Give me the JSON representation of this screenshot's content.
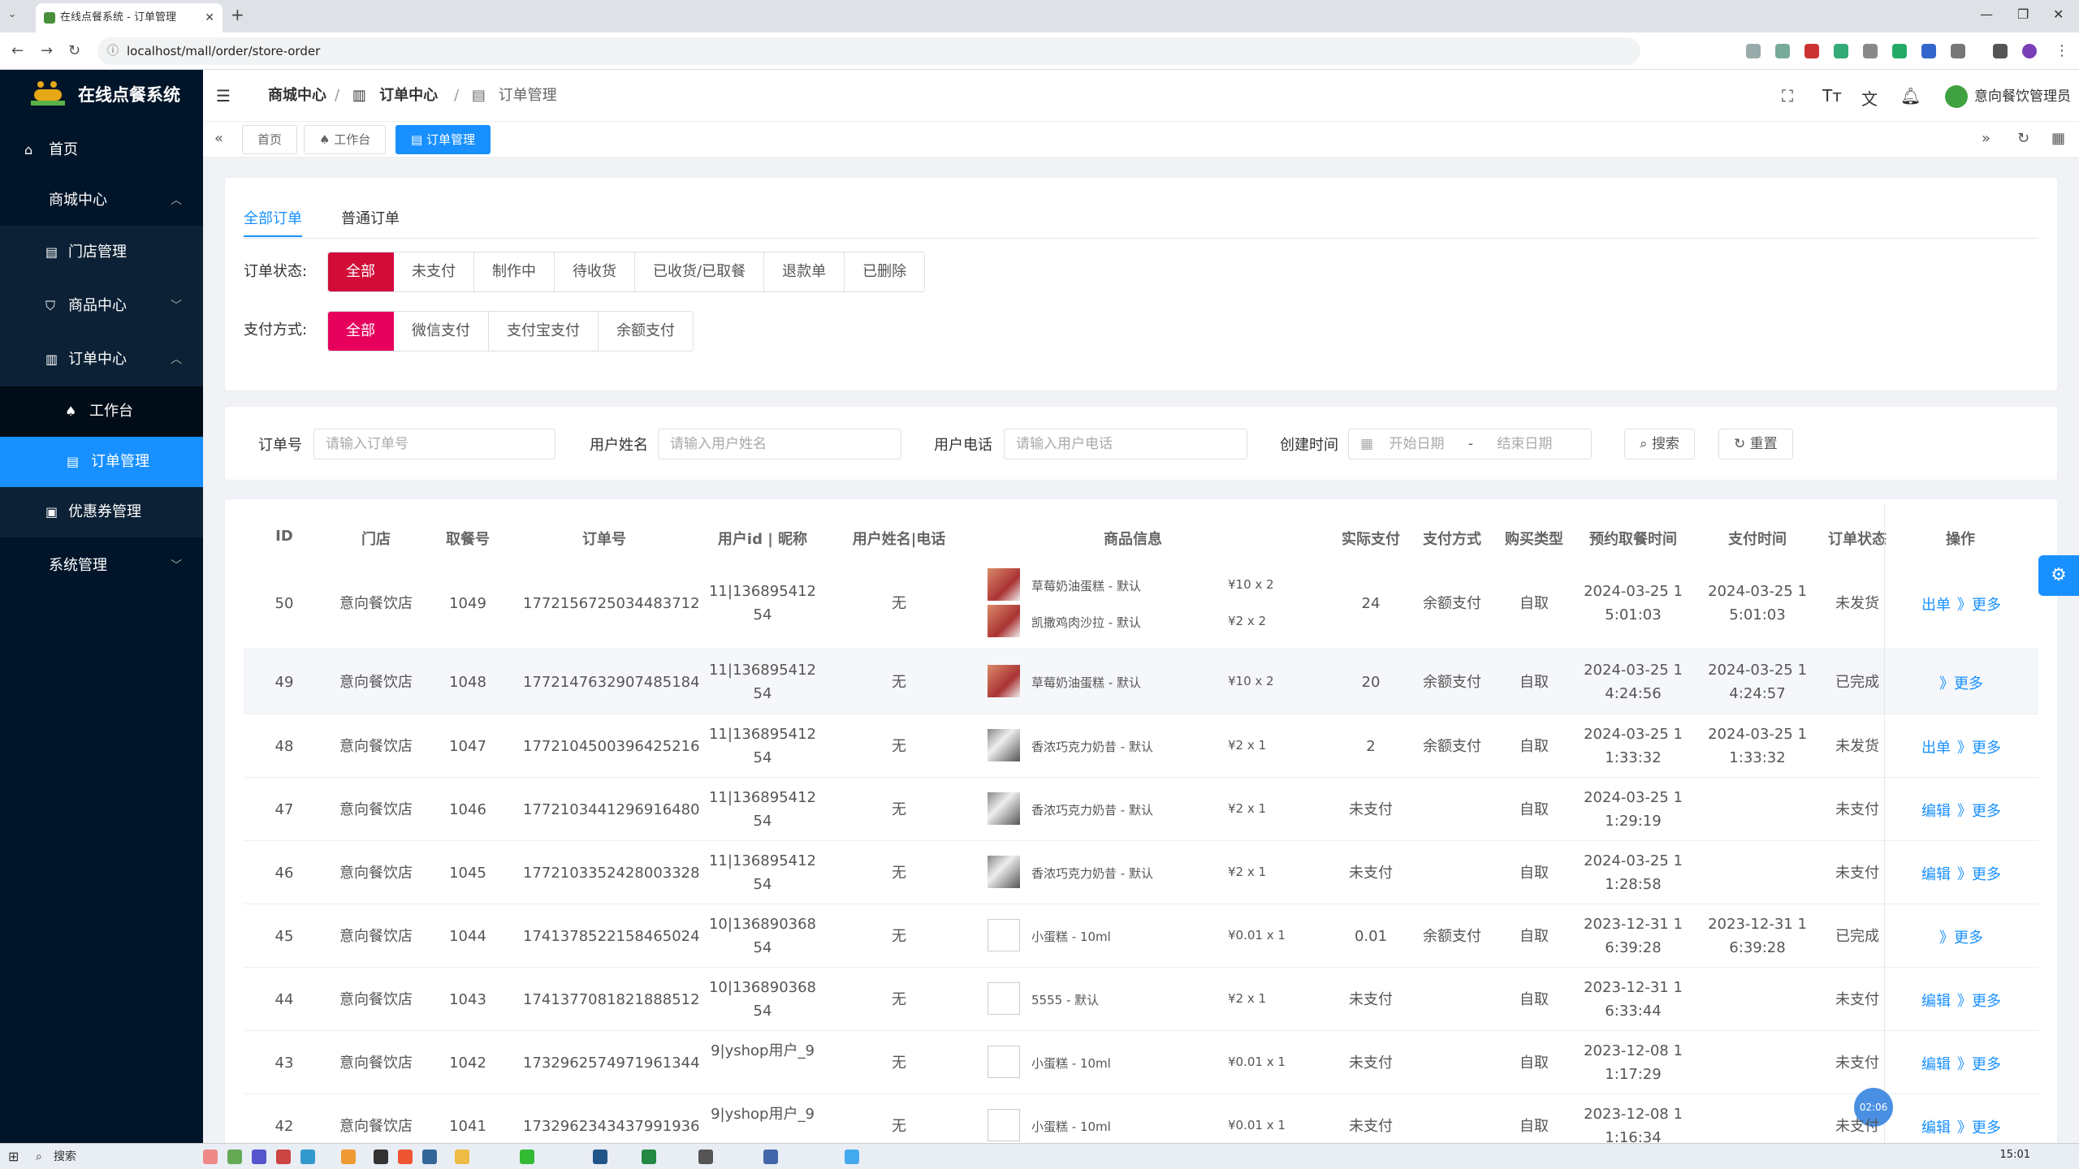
{
  "browser": {
    "tab_title": "在线点餐系统 - 订单管理",
    "url": "localhost/mall/order/store-order"
  },
  "app": {
    "name": "在线点餐系统"
  },
  "sidebar": {
    "home": "首页",
    "mall_center": "商城中心",
    "store_mgmt": "门店管理",
    "product_center": "商品中心",
    "order_center": "订单中心",
    "workbench": "工作台",
    "order_mgmt": "订单管理",
    "coupon_mgmt": "优惠券管理",
    "system_mgmt": "系统管理"
  },
  "header": {
    "breadcrumb": [
      "商城中心",
      "订单中心",
      "订单管理"
    ],
    "user": "意向餐饮管理员"
  },
  "tags": [
    "首页",
    "工作台",
    "订单管理"
  ],
  "filters": {
    "tabs": [
      "全部订单",
      "普通订单"
    ],
    "status_label": "订单状态:",
    "status_options": [
      "全部",
      "未支付",
      "制作中",
      "待收货",
      "已收货/已取餐",
      "退款单",
      "已删除"
    ],
    "pay_label": "支付方式:",
    "pay_options": [
      "全部",
      "微信支付",
      "支付宝支付",
      "余额支付"
    ]
  },
  "search": {
    "order_no_label": "订单号",
    "order_no_placeholder": "请输入订单号",
    "user_name_label": "用户姓名",
    "user_name_placeholder": "请输入用户姓名",
    "user_phone_label": "用户电话",
    "user_phone_placeholder": "请输入用户电话",
    "created_label": "创建时间",
    "start_date": "开始日期",
    "dash": "-",
    "end_date": "结束日期",
    "search_btn": "搜索",
    "reset_btn": "重置"
  },
  "table": {
    "headers": [
      "ID",
      "门店",
      "取餐号",
      "订单号",
      "用户id | 昵称",
      "用户姓名|电话",
      "商品信息",
      "实际支付",
      "支付方式",
      "购买类型",
      "预约取餐时间",
      "支付时间",
      "订单状态",
      "操作"
    ],
    "rows": [
      {
        "id": "50",
        "store": "意向餐饮店",
        "pickup": "1049",
        "order_no": "1772156725034483712",
        "user1": "11|136895412",
        "user2": "54",
        "name": "无",
        "products": [
          {
            "name": "草莓奶油蛋糕 - 默认",
            "qty": "¥10 x 2",
            "img": "photo"
          },
          {
            "name": "凯撒鸡肉沙拉 - 默认",
            "qty": "¥2 x 2",
            "img": "photo"
          }
        ],
        "paid": "24",
        "method": "余额支付",
        "type": "自取",
        "reserve1": "2024-03-25 1",
        "reserve2": "5:01:03",
        "paytime1": "2024-03-25 1",
        "paytime2": "5:01:03",
        "status": "未发货",
        "ops": [
          "出单",
          "》更多"
        ]
      },
      {
        "id": "49",
        "store": "意向餐饮店",
        "pickup": "1048",
        "order_no": "1772147632907485184",
        "user1": "11|136895412",
        "user2": "54",
        "name": "无",
        "products": [
          {
            "name": "草莓奶油蛋糕 - 默认",
            "qty": "¥10 x 2",
            "img": "photo"
          }
        ],
        "paid": "20",
        "method": "余额支付",
        "type": "自取",
        "reserve1": "2024-03-25 1",
        "reserve2": "4:24:56",
        "paytime1": "2024-03-25 1",
        "paytime2": "4:24:57",
        "status": "已完成",
        "ops": [
          "》更多"
        ]
      },
      {
        "id": "48",
        "store": "意向餐饮店",
        "pickup": "1047",
        "order_no": "1772104500396425216",
        "user1": "11|136895412",
        "user2": "54",
        "name": "无",
        "products": [
          {
            "name": "香浓巧克力奶昔 - 默认",
            "qty": "¥2 x 1",
            "img": "shake"
          }
        ],
        "paid": "2",
        "method": "余额支付",
        "type": "自取",
        "reserve1": "2024-03-25 1",
        "reserve2": "1:33:32",
        "paytime1": "2024-03-25 1",
        "paytime2": "1:33:32",
        "status": "未发货",
        "ops": [
          "出单",
          "》更多"
        ]
      },
      {
        "id": "47",
        "store": "意向餐饮店",
        "pickup": "1046",
        "order_no": "1772103441296916480",
        "user1": "11|136895412",
        "user2": "54",
        "name": "无",
        "products": [
          {
            "name": "香浓巧克力奶昔 - 默认",
            "qty": "¥2 x 1",
            "img": "shake"
          }
        ],
        "paid": "未支付",
        "method": "",
        "type": "自取",
        "reserve1": "2024-03-25 1",
        "reserve2": "1:29:19",
        "paytime1": "",
        "paytime2": "",
        "status": "未支付",
        "ops": [
          "编辑",
          "》更多"
        ]
      },
      {
        "id": "46",
        "store": "意向餐饮店",
        "pickup": "1045",
        "order_no": "1772103352428003328",
        "user1": "11|136895412",
        "user2": "54",
        "name": "无",
        "products": [
          {
            "name": "香浓巧克力奶昔 - 默认",
            "qty": "¥2 x 1",
            "img": "shake"
          }
        ],
        "paid": "未支付",
        "method": "",
        "type": "自取",
        "reserve1": "2024-03-25 1",
        "reserve2": "1:28:58",
        "paytime1": "",
        "paytime2": "",
        "status": "未支付",
        "ops": [
          "编辑",
          "》更多"
        ]
      },
      {
        "id": "45",
        "store": "意向餐饮店",
        "pickup": "1044",
        "order_no": "1741378522158465024",
        "user1": "10|136890368",
        "user2": "54",
        "name": "无",
        "products": [
          {
            "name": "小蛋糕 - 10ml",
            "qty": "¥0.01 x 1",
            "img": "blank"
          }
        ],
        "paid": "0.01",
        "method": "余额支付",
        "type": "自取",
        "reserve1": "2023-12-31 1",
        "reserve2": "6:39:28",
        "paytime1": "2023-12-31 1",
        "paytime2": "6:39:28",
        "status": "已完成",
        "ops": [
          "》更多"
        ]
      },
      {
        "id": "44",
        "store": "意向餐饮店",
        "pickup": "1043",
        "order_no": "1741377081821888512",
        "user1": "10|136890368",
        "user2": "54",
        "name": "无",
        "products": [
          {
            "name": "5555 - 默认",
            "qty": "¥2 x 1",
            "img": "blank"
          }
        ],
        "paid": "未支付",
        "method": "",
        "type": "自取",
        "reserve1": "2023-12-31 1",
        "reserve2": "6:33:44",
        "paytime1": "",
        "paytime2": "",
        "status": "未支付",
        "ops": [
          "编辑",
          "》更多"
        ]
      },
      {
        "id": "43",
        "store": "意向餐饮店",
        "pickup": "1042",
        "order_no": "1732962574971961344",
        "user1": "9|yshop用户_9",
        "user2": "",
        "name": "无",
        "products": [
          {
            "name": "小蛋糕 - 10ml",
            "qty": "¥0.01 x 1",
            "img": "blank"
          }
        ],
        "paid": "未支付",
        "method": "",
        "type": "自取",
        "reserve1": "2023-12-08 1",
        "reserve2": "1:17:29",
        "paytime1": "",
        "paytime2": "",
        "status": "未支付",
        "ops": [
          "编辑",
          "》更多"
        ]
      },
      {
        "id": "42",
        "store": "意向餐饮店",
        "pickup": "1041",
        "order_no": "1732962343437991936",
        "user1": "9|yshop用户_9",
        "user2": "",
        "name": "无",
        "products": [
          {
            "name": "小蛋糕 - 10ml",
            "qty": "¥0.01 x 1",
            "img": "blank"
          }
        ],
        "paid": "未支付",
        "method": "",
        "type": "自取",
        "reserve1": "2023-12-08 1",
        "reserve2": "1:16:34",
        "paytime1": "",
        "paytime2": "",
        "status": "未支付",
        "ops": [
          "编辑",
          "》更多"
        ]
      }
    ]
  },
  "float_timer": "02:06",
  "taskbar": {
    "search": "搜索",
    "time": "15:01"
  }
}
